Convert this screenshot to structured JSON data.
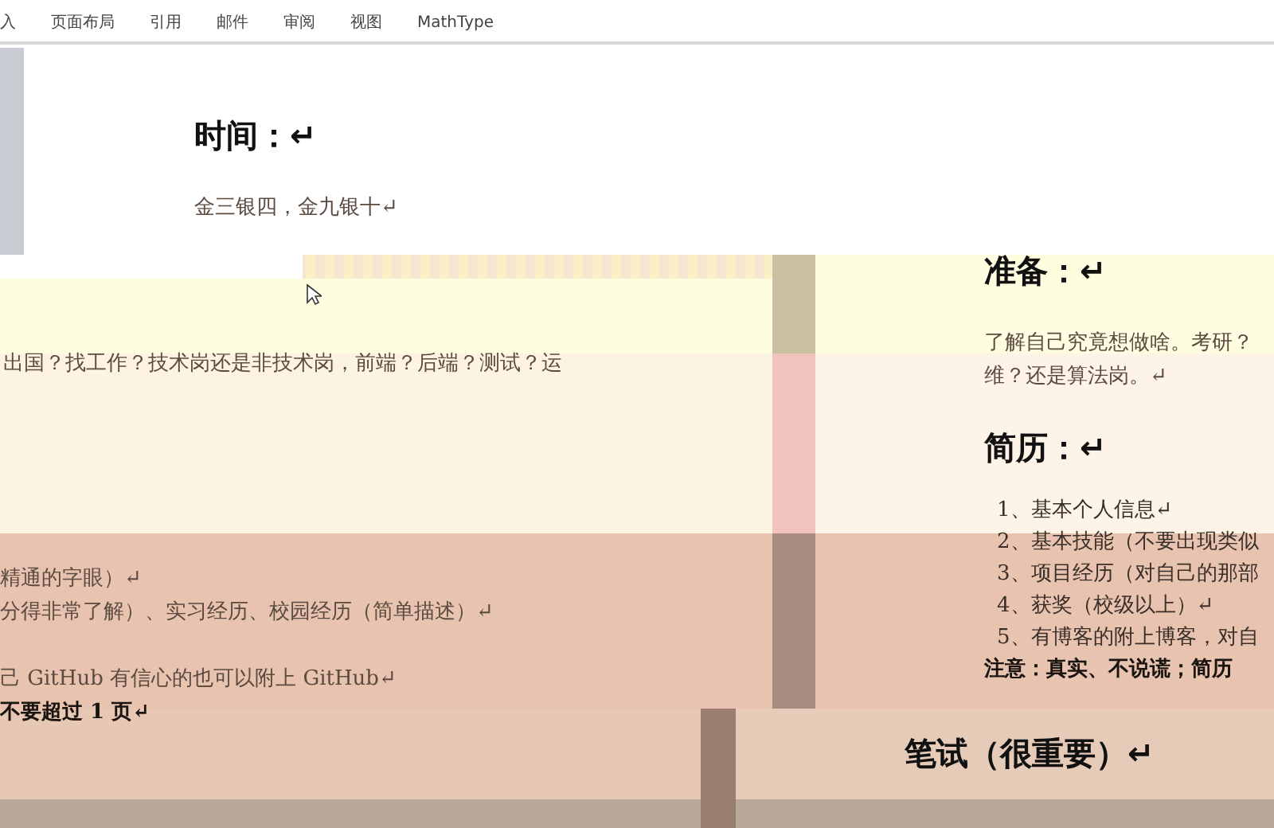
{
  "ribbon": {
    "tabs": [
      {
        "label": "入",
        "selected": false
      },
      {
        "label": "页面布局",
        "selected": false
      },
      {
        "label": "引用",
        "selected": false
      },
      {
        "label": "邮件",
        "selected": false
      },
      {
        "label": "审阅",
        "selected": false
      },
      {
        "label": "视图",
        "selected": false
      },
      {
        "label": "MathType",
        "selected": false
      }
    ]
  },
  "fragments": [
    {
      "lines": [
        {
          "kind": "heading",
          "text": "时间：↵"
        },
        {
          "kind": "body",
          "text": "金三银四，金九银十↵"
        }
      ]
    },
    {
      "lines": [
        {
          "kind": "body",
          "text": "出国？找工作？技术岗还是非技术岗，前端？后端？测试？运"
        }
      ]
    },
    {
      "lines": [
        {
          "kind": "heading",
          "text": "准备：↵"
        },
        {
          "kind": "body",
          "text": "了解自己究竟想做啥。考研？"
        },
        {
          "kind": "body",
          "text": "维？还是算法岗。↵"
        },
        {
          "kind": "heading",
          "text": "简历：↵"
        },
        {
          "kind": "list",
          "text": "1、基本个人信息↵"
        },
        {
          "kind": "list",
          "text": "2、基本技能（不要出现类似"
        },
        {
          "kind": "list",
          "text": "3、项目经历（对自己的那部"
        },
        {
          "kind": "list",
          "text": "4、获奖（校级以上）↵"
        },
        {
          "kind": "list",
          "text": "5、有博客的附上博客，对自"
        },
        {
          "kind": "note",
          "text": "注意：真实、不说谎；简历"
        }
      ]
    },
    {
      "lines": [
        {
          "kind": "body",
          "text": "精通的字眼）↵"
        },
        {
          "kind": "body",
          "text": "分得非常了解）、实习经历、校园经历（简单描述）↵"
        },
        {
          "kind": "body",
          "text": "己 GitHub 有信心的也可以附上 GitHub↵"
        },
        {
          "kind": "note",
          "text": "不要超过 1 页↵"
        }
      ]
    },
    {
      "lines": [
        {
          "kind": "heading",
          "text": "笔试（很重要）↵"
        }
      ]
    }
  ]
}
